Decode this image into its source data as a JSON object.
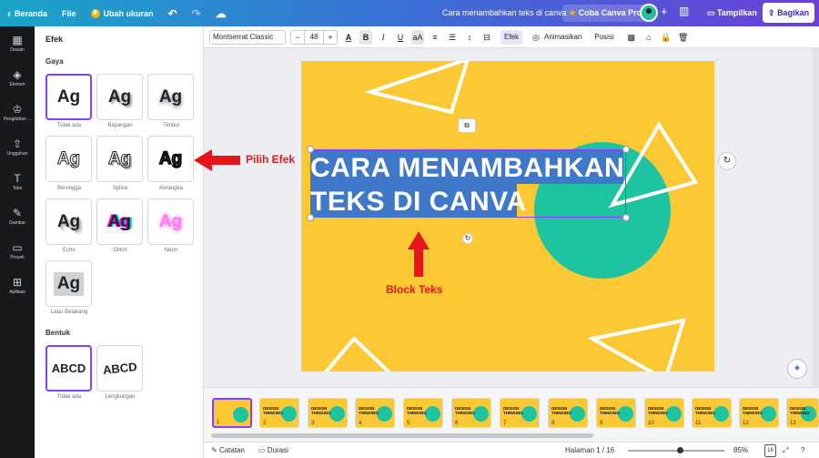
{
  "topbar": {
    "home_label": "Beranda",
    "file_label": "File",
    "resize_label": "Ubah ukuran",
    "doc_title": "Cara menambahkan teks di canva",
    "try_pro_label": "Coba Canva Pro",
    "present_label": "Tampilkan",
    "share_label": "Bagikan"
  },
  "sidebar": {
    "items": [
      {
        "label": "Desain",
        "icon": "design-icon"
      },
      {
        "label": "Elemen",
        "icon": "elements-icon"
      },
      {
        "label": "Pengilattan ...",
        "icon": "brand-icon"
      },
      {
        "label": "Unggahan",
        "icon": "upload-icon"
      },
      {
        "label": "Teks",
        "icon": "text-icon"
      },
      {
        "label": "Gambar",
        "icon": "draw-icon"
      },
      {
        "label": "Proyek",
        "icon": "folder-icon"
      },
      {
        "label": "Aplikasi",
        "icon": "apps-icon"
      }
    ]
  },
  "panel": {
    "title": "Efek",
    "style_section": "Gaya",
    "styles": [
      {
        "label": "Tidak ada",
        "sample": "Ag"
      },
      {
        "label": "Bayangan",
        "sample": "Ag"
      },
      {
        "label": "Timbul",
        "sample": "Ag"
      },
      {
        "label": "Berongga",
        "sample": "Ag"
      },
      {
        "label": "Splice",
        "sample": "Ag"
      },
      {
        "label": "Kerangka",
        "sample": "Ag"
      },
      {
        "label": "Echo",
        "sample": "Ag"
      },
      {
        "label": "Glitch",
        "sample": "Ag"
      },
      {
        "label": "Neon",
        "sample": "Ag"
      },
      {
        "label": "Latar Belakang",
        "sample": "Ag"
      }
    ],
    "shape_section": "Bentuk",
    "shapes": [
      {
        "label": "Tidak ada",
        "sample": "ABCD"
      },
      {
        "label": "Lengkungan",
        "sample": "ABCD"
      }
    ]
  },
  "toolbar": {
    "font_name": "Montserrat Classic",
    "font_size": "48",
    "minus": "−",
    "plus": "+",
    "bold": "B",
    "italic": "I",
    "underline": "U",
    "case": "aA",
    "effects_label": "Efek",
    "animate_label": "Animasikan",
    "position_label": "Posisi"
  },
  "canvas": {
    "heading_line1": "CARA MENAMBAHKAN",
    "heading_line2": "TEKS DI CANVA"
  },
  "annotations": {
    "pick_effect": "Pilih Efek",
    "block_text": "Block Teks"
  },
  "thumbnails": {
    "text": "DESIGN THINKING",
    "pages": [
      "1",
      "2",
      "3",
      "4",
      "5",
      "6",
      "7",
      "8",
      "9",
      "10",
      "11",
      "12",
      "13"
    ]
  },
  "bottombar": {
    "notes_label": "Catatan",
    "duration_label": "Durasi",
    "page_indicator": "Halaman 1 / 16",
    "zoom": "85%",
    "pages_badge": "16"
  },
  "colors": {
    "accent": "#8b3dff",
    "page_bg": "#fcc834",
    "circle": "#1ec3a0",
    "annotation": "#e8141b"
  }
}
